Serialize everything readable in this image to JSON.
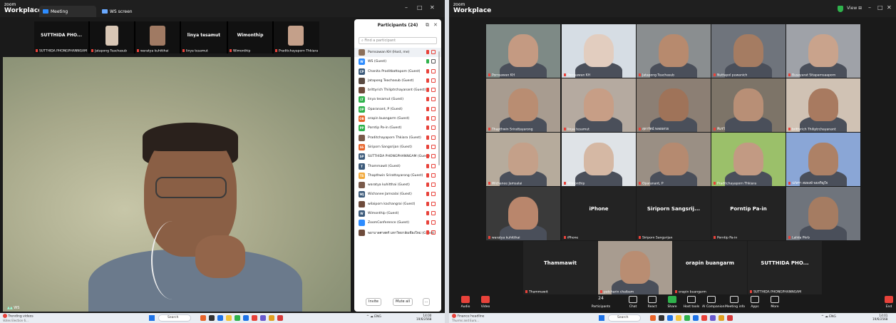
{
  "left": {
    "logo": {
      "brand": "zoom",
      "product": "Workplace"
    },
    "tabs": [
      {
        "label": "Meeting"
      },
      {
        "label": "WS screen"
      }
    ],
    "window_controls": [
      "–",
      "□",
      "✕"
    ],
    "strip": [
      {
        "display_name": "SUTTHIDA PHO...",
        "label": "SUTTHIDA PHONGPHANNGAM"
      },
      {
        "display_name": "",
        "label": "Jatapong Teachasub"
      },
      {
        "display_name": "",
        "label": "waratya kuhitthai"
      },
      {
        "display_name": "linya tesamut",
        "label": "linya tesamut"
      },
      {
        "display_name": "Wimonthip",
        "label": "Wimonthip"
      },
      {
        "display_name": "",
        "label": "Praditchayaporn Thkiara"
      }
    ],
    "main_video_label": "WS",
    "panel": {
      "title": "Participants (24)",
      "search_placeholder": "Find a participant",
      "participants": [
        {
          "name": "Pornsawan KH (Host, me)",
          "avatar": "",
          "color": "#8b6f5a"
        },
        {
          "name": "WS (Guest)",
          "avatar": "W",
          "color": "#2d8cff"
        },
        {
          "name": "Chanita Praditbattapom (Guest)",
          "avatar": "CP",
          "color": "#3c5a7a"
        },
        {
          "name": "Jatapong Teachasub (Guest)",
          "avatar": "",
          "color": "#5a4a42"
        },
        {
          "name": "brittyrich Thiliptrchayanant (Guest)",
          "avatar": "",
          "color": "#6e4b3b"
        },
        {
          "name": "linya tesamut (Guest)",
          "avatar": "LT",
          "color": "#2fb24c"
        },
        {
          "name": "Oparanant, P (Guest)",
          "avatar": "OP",
          "color": "#2fb24c"
        },
        {
          "name": "orapin buangarm (Guest)",
          "avatar": "OB",
          "color": "#e8642a"
        },
        {
          "name": "Porntip Pa-in (Guest)",
          "avatar": "PP",
          "color": "#2fb24c"
        },
        {
          "name": "Praditchayaporn Thkiara (Guest)",
          "avatar": "",
          "color": "#7a5a4a"
        },
        {
          "name": "Siriporn Sangsrijan (Guest)",
          "avatar": "SS",
          "color": "#e8642a"
        },
        {
          "name": "SUTTHIDA PHONGPHANNGAM (Guest)",
          "avatar": "SP",
          "color": "#3c5a7a"
        },
        {
          "name": "Thammawit (Guest)",
          "avatar": "T",
          "color": "#3c5a7a"
        },
        {
          "name": "Thapthwin Srirattayarong (Guest)",
          "avatar": "TS",
          "color": "#f2a93b"
        },
        {
          "name": "waratya kuhitthai (Guest)",
          "avatar": "",
          "color": "#7a5a4a"
        },
        {
          "name": "Wichanee Jamsalai (Guest)",
          "avatar": "WJ",
          "color": "#3c5a7a"
        },
        {
          "name": "wilaiporn kachangrai (Guest)",
          "avatar": "",
          "color": "#6e4b3b"
        },
        {
          "name": "Wimonthip (Guest)",
          "avatar": "W",
          "color": "#3c5a7a"
        },
        {
          "name": "ZoomConference (Guest)",
          "avatar": "",
          "color": "#2d8cff"
        },
        {
          "name": "พยาบาลศาสตร์ มหาวิทยาลัยเชียงใหม่ (Guest)",
          "avatar": "",
          "color": "#6e4b3b"
        }
      ],
      "invite_label": "Invite",
      "mute_all_label": "Mute all",
      "more_label": "..."
    },
    "taskbar": {
      "news_title": "Trending videos",
      "news_sub": "Votes Election 6...",
      "search_label": "Search",
      "tray_label": "^ ☁ ENG",
      "time": "14:00",
      "date": "19/6/2568"
    }
  },
  "right": {
    "logo": {
      "brand": "zoom",
      "product": "Workplace"
    },
    "view_label": "View",
    "window_controls": [
      "–",
      "□",
      "✕"
    ],
    "gallery": [
      {
        "label": "Pornsawan KH",
        "name": ""
      },
      {
        "label": "Pornsawan KH",
        "name": ""
      },
      {
        "label": "Jatapong Teachasub",
        "name": ""
      },
      {
        "label": "Nuttapol puwanich",
        "name": ""
      },
      {
        "label": "Busayarat Sitaparnsaaporn",
        "name": ""
      },
      {
        "label": "Thapthwin Srirattayarong",
        "name": ""
      },
      {
        "label": "linya tesamut",
        "name": ""
      },
      {
        "label": "สุดารัตน์ พลอยสวย",
        "name": ""
      },
      {
        "label": "คิมรวี",
        "name": ""
      },
      {
        "label": "brittyrich Thiliptrchayanant",
        "name": ""
      },
      {
        "label": "Wichanee Jamsalai",
        "name": ""
      },
      {
        "label": "Wimonthip",
        "name": ""
      },
      {
        "label": "Oparanant, P",
        "name": ""
      },
      {
        "label": "Praditchayaporn Thkiara",
        "name": ""
      },
      {
        "label": "ปภัสรา สมพงษ์ จงเจริญใจ",
        "name": ""
      },
      {
        "label": "waratya kuhitthai",
        "name": ""
      },
      {
        "label": "iPhone",
        "name": "iPhone"
      },
      {
        "label": "Siriporn Sangsrijan",
        "name": "Siriporn Sangsrij..."
      },
      {
        "label": "Porntip Pa-in",
        "name": "Porntip Pa-in"
      },
      {
        "label": "Lalida Pkrb",
        "name": ""
      },
      {
        "label": "Thammawit",
        "name": "Thammawit"
      },
      {
        "label": "patcharin chaibam",
        "name": ""
      },
      {
        "label": "orapin buangarm",
        "name": "orapin buangarm"
      },
      {
        "label": "SUTTHIDA PHONGPHANNGAM",
        "name": "SUTTHIDA PHO..."
      }
    ],
    "toolbar": [
      {
        "label": "Audio",
        "icon": "mic-icon"
      },
      {
        "label": "Video",
        "icon": "video-icon"
      },
      {
        "label": "Participants",
        "icon": "people-icon",
        "badge": "24"
      },
      {
        "label": "Chat",
        "icon": "chat-icon"
      },
      {
        "label": "React",
        "icon": "heart-icon"
      },
      {
        "label": "Share",
        "icon": "share-icon"
      },
      {
        "label": "Host tools",
        "icon": "shield-icon"
      },
      {
        "label": "AI Companion",
        "icon": "sparkle-icon"
      },
      {
        "label": "Meeting info",
        "icon": "info-icon"
      },
      {
        "label": "Apps",
        "icon": "apps-icon"
      },
      {
        "label": "More",
        "icon": "more-icon"
      },
      {
        "label": "End",
        "icon": "end-icon"
      }
    ],
    "taskbar": {
      "news_title": "Finance headline",
      "news_sub": "Thurms and Euro...",
      "search_label": "Search",
      "tray_label": "^ ☁ ENG",
      "time": "14:01",
      "date": "19/6/2568"
    }
  }
}
